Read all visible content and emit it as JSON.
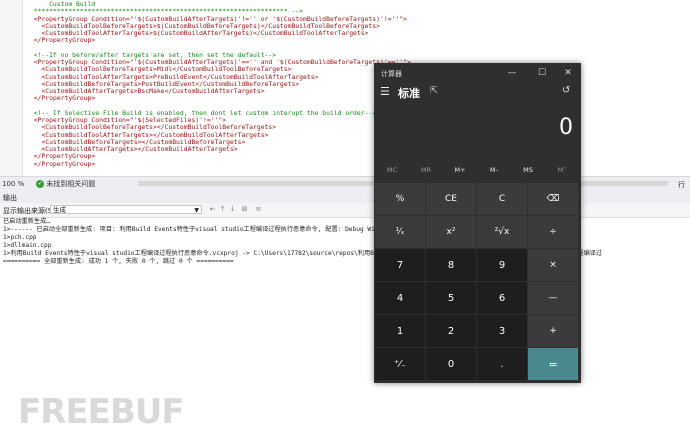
{
  "editor": {
    "lines": [
      {
        "cls": "c-comment",
        "text": "      Custom Build"
      },
      {
        "cls": "c-comment",
        "text": "  ****************************************************************** -->"
      },
      {
        "cls": "c-xml",
        "text": "  <PropertyGroup Condition=\"'$(CustomBuildAfterTargets)'!='' or '$(CustomBuildBeforeTargets)'!=''\">"
      },
      {
        "cls": "c-xml",
        "text": "    <CustomBuildToolBeforeTargets>$(CustomBuildBeforeTargets)</CustomBuildToolBeforeTargets>"
      },
      {
        "cls": "c-xml",
        "text": "    <CustomBuildToolAfterTargets>$(CustomBuildAfterTargets)</CustomBuildToolAfterTargets>"
      },
      {
        "cls": "c-xml",
        "text": "  </PropertyGroup>"
      },
      {
        "cls": "c-dark",
        "text": ""
      },
      {
        "cls": "c-comment",
        "text": "  <!--If no before/after targets are set, then set the default-->"
      },
      {
        "cls": "c-xml",
        "text": "  <PropertyGroup Condition=\"'$(CustomBuildAfterTargets)'=='' and '$(CustomBuildBeforeTargets)'==''\">"
      },
      {
        "cls": "c-xml",
        "text": "    <CustomBuildToolBeforeTargets>Midl</CustomBuildToolBeforeTargets>"
      },
      {
        "cls": "c-xml",
        "text": "    <CustomBuildToolAfterTargets>PreBuildEvent</CustomBuildToolAfterTargets>"
      },
      {
        "cls": "c-xml",
        "text": "    <CustomBuildBeforeTargets>PostBuildEvent</CustomBuildBeforeTargets>"
      },
      {
        "cls": "c-xml",
        "text": "    <CustomBuildAfterTargets>BscMake</CustomBuildAfterTargets>"
      },
      {
        "cls": "c-xml",
        "text": "  </PropertyGroup>"
      },
      {
        "cls": "c-dark",
        "text": ""
      },
      {
        "cls": "c-comment",
        "text": "  <!-- If Selective File Build is enabled, then dont let custom interupt the build order-->"
      },
      {
        "cls": "c-xml",
        "text": "  <PropertyGroup Condition=\"'$(SelectedFiles)'!=''\">"
      },
      {
        "cls": "c-xml",
        "text": "    <CustomBuildToolBeforeTargets></CustomBuildToolBeforeTargets>"
      },
      {
        "cls": "c-xml",
        "text": "    <CustomBuildToolAfterTargets></CustomBuildToolAfterTargets>"
      },
      {
        "cls": "c-xml",
        "text": "    <CustomBuildBeforeTargets></CustomBuildBeforeTargets>"
      },
      {
        "cls": "c-xml",
        "text": "    <CustomBuildAfterTargets></CustomBuildAfterTargets>"
      },
      {
        "cls": "c-xml",
        "text": "  </PropertyGroup>"
      },
      {
        "cls": "c-xml",
        "text": "  </PropertyGroup>"
      },
      {
        "cls": "c-xml",
        "text": "    "
      }
    ]
  },
  "statusbar": {
    "zoom": "100 %",
    "issues": "未找到相关问题",
    "row": "行"
  },
  "output": {
    "header": "输出",
    "source_label": "显示输出来源(S):",
    "source_value": "生成",
    "lines": [
      "已启动重新生成…",
      "1>------ 已启动全部重新生成: 项目: 利用Build Events特性于visual studio工程编译过程执行恶意命令, 配置: Debug Win32 ------",
      "1>pch.cpp",
      "1>dllmain.cpp",
      "1>利用Build Events特性于visual studio工程编译过程执行恶意命令.vcxproj -> C:\\Users\\17782\\source\\repos\\利用Build Ev                      Events特性于visual studio工程编译过",
      "========== 全部重新生成: 成功 1 个, 失败 0 个, 跳过 0 个 =========="
    ]
  },
  "watermark": "FREEBUF",
  "calculator": {
    "title": "计算器",
    "minimize": "—",
    "maximize": "☐",
    "close": "✕",
    "menu_icon": "hamburger-icon",
    "mode": "标准",
    "keep_on_top_icon": "keep-on-top-icon",
    "history_icon": "history-icon",
    "display": "0",
    "memory": [
      {
        "label": "MC",
        "enabled": false
      },
      {
        "label": "MR",
        "enabled": false
      },
      {
        "label": "M+",
        "enabled": true
      },
      {
        "label": "M-",
        "enabled": true
      },
      {
        "label": "MS",
        "enabled": true
      },
      {
        "label": "M˅",
        "enabled": false
      }
    ],
    "keys": [
      {
        "label": "%",
        "kind": "op",
        "name": "percent-key"
      },
      {
        "label": "CE",
        "kind": "op",
        "name": "clear-entry-key"
      },
      {
        "label": "C",
        "kind": "op",
        "name": "clear-key"
      },
      {
        "label": "⌫",
        "kind": "op",
        "name": "backspace-key"
      },
      {
        "label": "¹⁄ₓ",
        "kind": "op",
        "name": "reciprocal-key"
      },
      {
        "label": "x²",
        "kind": "op",
        "name": "square-key"
      },
      {
        "label": "²√x",
        "kind": "op",
        "name": "sqrt-key"
      },
      {
        "label": "÷",
        "kind": "op",
        "name": "divide-key"
      },
      {
        "label": "7",
        "kind": "num",
        "name": "digit-7-key"
      },
      {
        "label": "8",
        "kind": "num",
        "name": "digit-8-key"
      },
      {
        "label": "9",
        "kind": "num",
        "name": "digit-9-key"
      },
      {
        "label": "×",
        "kind": "op",
        "name": "multiply-key"
      },
      {
        "label": "4",
        "kind": "num",
        "name": "digit-4-key"
      },
      {
        "label": "5",
        "kind": "num",
        "name": "digit-5-key"
      },
      {
        "label": "6",
        "kind": "num",
        "name": "digit-6-key"
      },
      {
        "label": "—",
        "kind": "op",
        "name": "subtract-key"
      },
      {
        "label": "1",
        "kind": "num",
        "name": "digit-1-key"
      },
      {
        "label": "2",
        "kind": "num",
        "name": "digit-2-key"
      },
      {
        "label": "3",
        "kind": "num",
        "name": "digit-3-key"
      },
      {
        "label": "+",
        "kind": "op",
        "name": "add-key"
      },
      {
        "label": "⁺⁄₋",
        "kind": "num",
        "name": "negate-key"
      },
      {
        "label": "0",
        "kind": "num",
        "name": "digit-0-key"
      },
      {
        "label": ".",
        "kind": "num",
        "name": "decimal-key"
      },
      {
        "label": "=",
        "kind": "eq",
        "name": "equals-key"
      }
    ]
  }
}
